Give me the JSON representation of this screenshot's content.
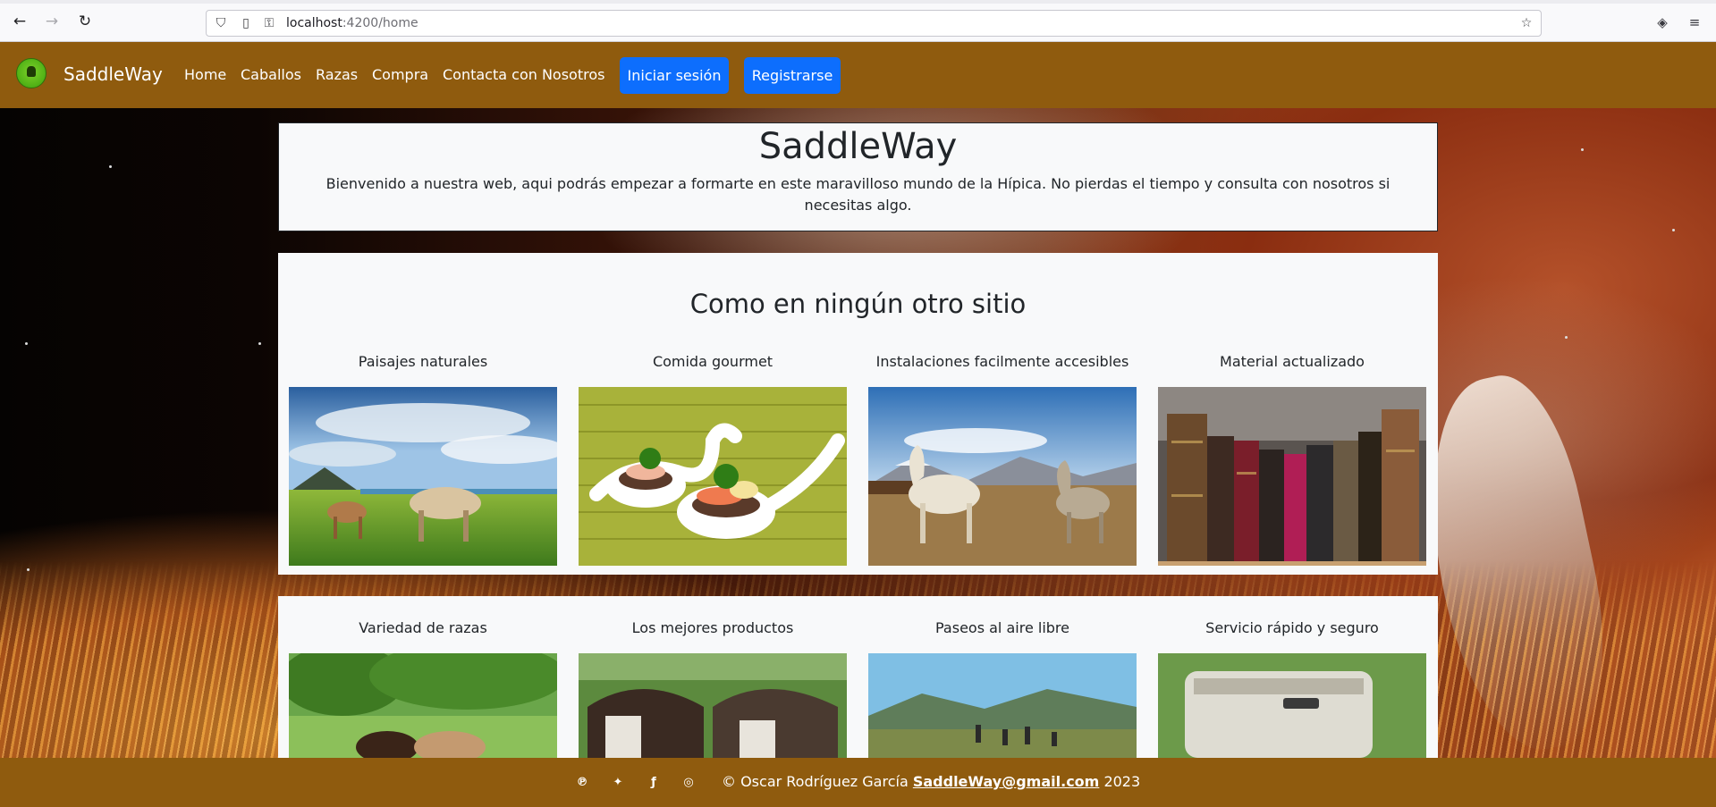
{
  "browser": {
    "url_host": "localhost",
    "url_path": ":4200/home"
  },
  "nav": {
    "brand": "SaddleWay",
    "links": [
      "Home",
      "Caballos",
      "Razas",
      "Compra",
      "Contacta con Nosotros"
    ],
    "login_label": "Iniciar sesión",
    "register_label": "Registrarse"
  },
  "welcome": {
    "title": "SaddleWay",
    "text": "Bienvenido a nuestra web, aqui podrás empezar a formarte en este maravilloso mundo de la Hípica. No pierdas el tiempo y consulta con nosotros si necesitas algo."
  },
  "section": {
    "title": "Como en ningún otro sitio",
    "features_row1": [
      "Paisajes naturales",
      "Comida gourmet",
      "Instalaciones facilmente accesibles",
      "Material actualizado"
    ],
    "features_row2": [
      "Variedad de razas",
      "Los mejores productos",
      "Paseos al aire libre",
      "Servicio rápido y seguro"
    ]
  },
  "footer": {
    "copyright": "© Oscar Rodríguez García",
    "email": "SaddleWay@gmail.com",
    "year": "2023",
    "social_icons": [
      "pinterest-icon",
      "twitter-icon",
      "facebook-icon",
      "instagram-icon"
    ]
  },
  "colors": {
    "nav_brown": "#8f5b0e",
    "button_blue": "#0d6efd",
    "panel_bg": "#f8f9fa"
  }
}
